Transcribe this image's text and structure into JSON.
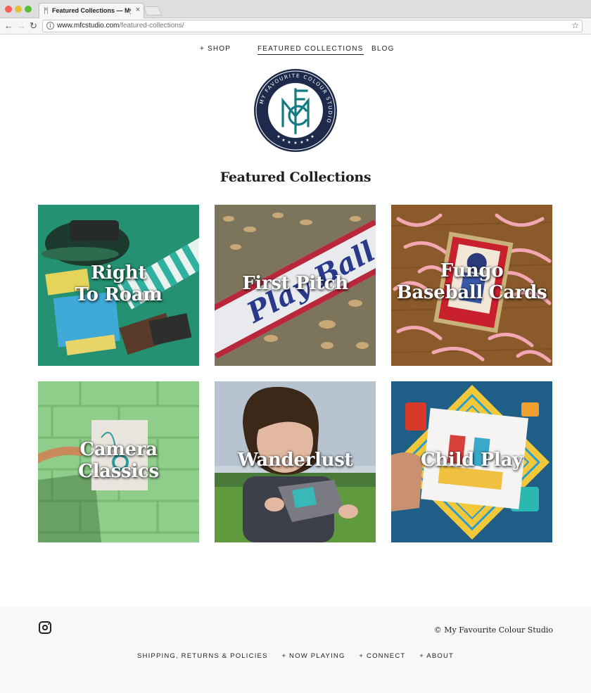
{
  "browser": {
    "tab_title": "Featured Collections — My F",
    "tab_favicon": "ᛗ",
    "url_domain": "www.mfcstudio.com",
    "url_path": "/featured-collections/"
  },
  "nav": {
    "shop": "+ SHOP",
    "featured": "FEATURED COLLECTIONS",
    "blog": "BLOG"
  },
  "logo": {
    "ring_text": "MY FAVOURITE COLOUR STUDIO",
    "monogram": "MFC",
    "colors": {
      "navy": "#1d2a4c",
      "teal": "#127a80"
    }
  },
  "page_title": "Featured Collections",
  "collections": [
    {
      "line1": "Right",
      "line2": "To Roam"
    },
    {
      "line1": "First Pitch",
      "line2": ""
    },
    {
      "line1": "Fungo",
      "line2": "Baseball Cards"
    },
    {
      "line1": "Camera",
      "line2": "Classics"
    },
    {
      "line1": "Wanderlust",
      "line2": ""
    },
    {
      "line1": "Child Play",
      "line2": ""
    }
  ],
  "footer": {
    "copyright": "© My Favourite Colour Studio",
    "links": [
      "SHIPPING, RETURNS & POLICIES",
      "+ NOW PLAYING",
      "+ CONNECT",
      "+ ABOUT"
    ]
  }
}
